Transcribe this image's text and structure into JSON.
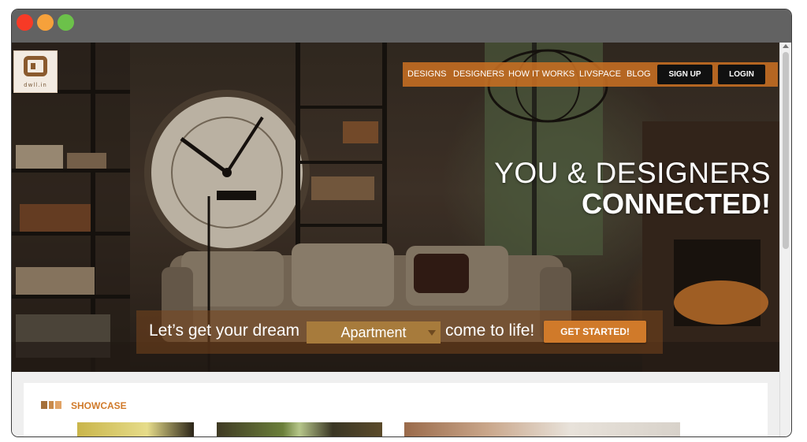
{
  "colors": {
    "accent": "#d07a2a",
    "nav_bg": "#c76e22",
    "button_dark": "#111111",
    "close": "#f73a26",
    "minimize": "#f6a13b",
    "maximize": "#6cc14a"
  },
  "logo": {
    "text": "dwll.in"
  },
  "nav": {
    "links": [
      "DESIGNS",
      "DESIGNERS",
      "HOW IT WORKS",
      "LIVSPACE",
      "BLOG"
    ],
    "signup_label": "SIGN UP",
    "login_label": "LOGIN"
  },
  "hero": {
    "headline_line1": "YOU & DESIGNERS",
    "headline_line2": "CONNECTED!",
    "cta_prefix": "Let’s get your dream",
    "cta_select_value": "Apartment",
    "cta_suffix": "come to life!",
    "cta_button": "GET STARTED!"
  },
  "showcase": {
    "title": "SHOWCASE"
  }
}
